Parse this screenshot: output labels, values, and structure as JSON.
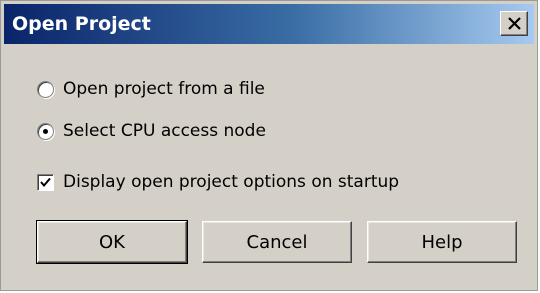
{
  "dialog": {
    "title": "Open Project",
    "close_icon": "close-icon"
  },
  "options": {
    "open_from_file": {
      "label": "Open project from a file",
      "selected": false
    },
    "select_cpu": {
      "label": "Select CPU access node",
      "selected": true
    },
    "display_on_startup": {
      "label": "Display open project options on startup",
      "checked": true
    }
  },
  "buttons": {
    "ok": "OK",
    "cancel": "Cancel",
    "help": "Help"
  }
}
